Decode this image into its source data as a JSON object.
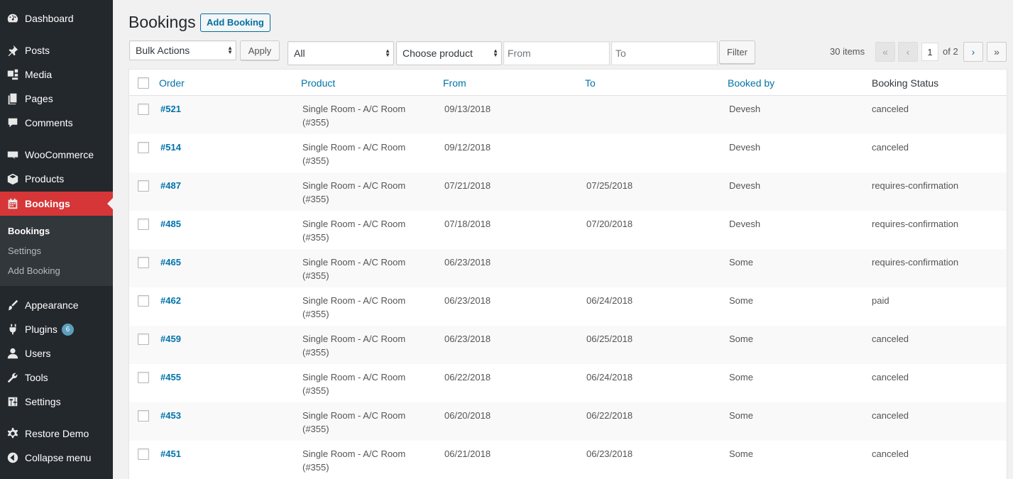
{
  "sidebar": {
    "items": [
      {
        "label": "Dashboard",
        "icon": "dashboard-icon"
      },
      {
        "label": "Posts",
        "icon": "pin-icon"
      },
      {
        "label": "Media",
        "icon": "media-icon"
      },
      {
        "label": "Pages",
        "icon": "pages-icon"
      },
      {
        "label": "Comments",
        "icon": "comment-icon"
      },
      {
        "label": "WooCommerce",
        "icon": "woo-icon"
      },
      {
        "label": "Products",
        "icon": "box-icon"
      },
      {
        "label": "Bookings",
        "icon": "calendar-icon"
      },
      {
        "label": "Appearance",
        "icon": "brush-icon"
      },
      {
        "label": "Plugins",
        "icon": "plug-icon",
        "badge": "6"
      },
      {
        "label": "Users",
        "icon": "user-icon"
      },
      {
        "label": "Tools",
        "icon": "wrench-icon"
      },
      {
        "label": "Settings",
        "icon": "sliders-icon"
      },
      {
        "label": "Restore Demo",
        "icon": "gear-icon"
      },
      {
        "label": "Collapse menu",
        "icon": "collapse-icon"
      }
    ],
    "submenu": [
      "Bookings",
      "Settings",
      "Add Booking"
    ],
    "active_color": "#d63638"
  },
  "header": {
    "title": "Bookings",
    "add_button": "Add Booking"
  },
  "toolbar": {
    "bulk_actions": "Bulk Actions",
    "apply": "Apply",
    "status_filter": "All",
    "product_filter": "Choose product",
    "from_placeholder": "From",
    "to_placeholder": "To",
    "filter": "Filter"
  },
  "pagination": {
    "items_count": "30 items",
    "first": "«",
    "prev": "‹",
    "current_page": "1",
    "of_pages": "of 2",
    "next": "›",
    "last": "»"
  },
  "table": {
    "columns": [
      "Order",
      "Product",
      "From",
      "To",
      "Booked by",
      "Booking Status"
    ],
    "rows": [
      {
        "order": "#521",
        "product": "Single Room - A/C Room (#355)",
        "from": "09/13/2018",
        "to": "",
        "booked_by": "Devesh",
        "status": "canceled"
      },
      {
        "order": "#514",
        "product": "Single Room - A/C Room (#355)",
        "from": "09/12/2018",
        "to": "",
        "booked_by": "Devesh",
        "status": "canceled"
      },
      {
        "order": "#487",
        "product": "Single Room - A/C Room (#355)",
        "from": "07/21/2018",
        "to": "07/25/2018",
        "booked_by": "Devesh",
        "status": "requires-confirmation"
      },
      {
        "order": "#485",
        "product": "Single Room - A/C Room (#355)",
        "from": "07/18/2018",
        "to": "07/20/2018",
        "booked_by": "Devesh",
        "status": "requires-confirmation"
      },
      {
        "order": "#465",
        "product": "Single Room - A/C Room (#355)",
        "from": "06/23/2018",
        "to": "",
        "booked_by": "Some",
        "status": "requires-confirmation"
      },
      {
        "order": "#462",
        "product": "Single Room - A/C Room (#355)",
        "from": "06/23/2018",
        "to": "06/24/2018",
        "booked_by": "Some",
        "status": "paid"
      },
      {
        "order": "#459",
        "product": "Single Room - A/C Room (#355)",
        "from": "06/23/2018",
        "to": "06/25/2018",
        "booked_by": "Some",
        "status": "canceled"
      },
      {
        "order": "#455",
        "product": "Single Room - A/C Room (#355)",
        "from": "06/22/2018",
        "to": "06/24/2018",
        "booked_by": "Some",
        "status": "canceled"
      },
      {
        "order": "#453",
        "product": "Single Room - A/C Room (#355)",
        "from": "06/20/2018",
        "to": "06/22/2018",
        "booked_by": "Some",
        "status": "canceled"
      },
      {
        "order": "#451",
        "product": "Single Room - A/C Room (#355)",
        "from": "06/21/2018",
        "to": "06/23/2018",
        "booked_by": "Some",
        "status": "canceled"
      }
    ]
  }
}
